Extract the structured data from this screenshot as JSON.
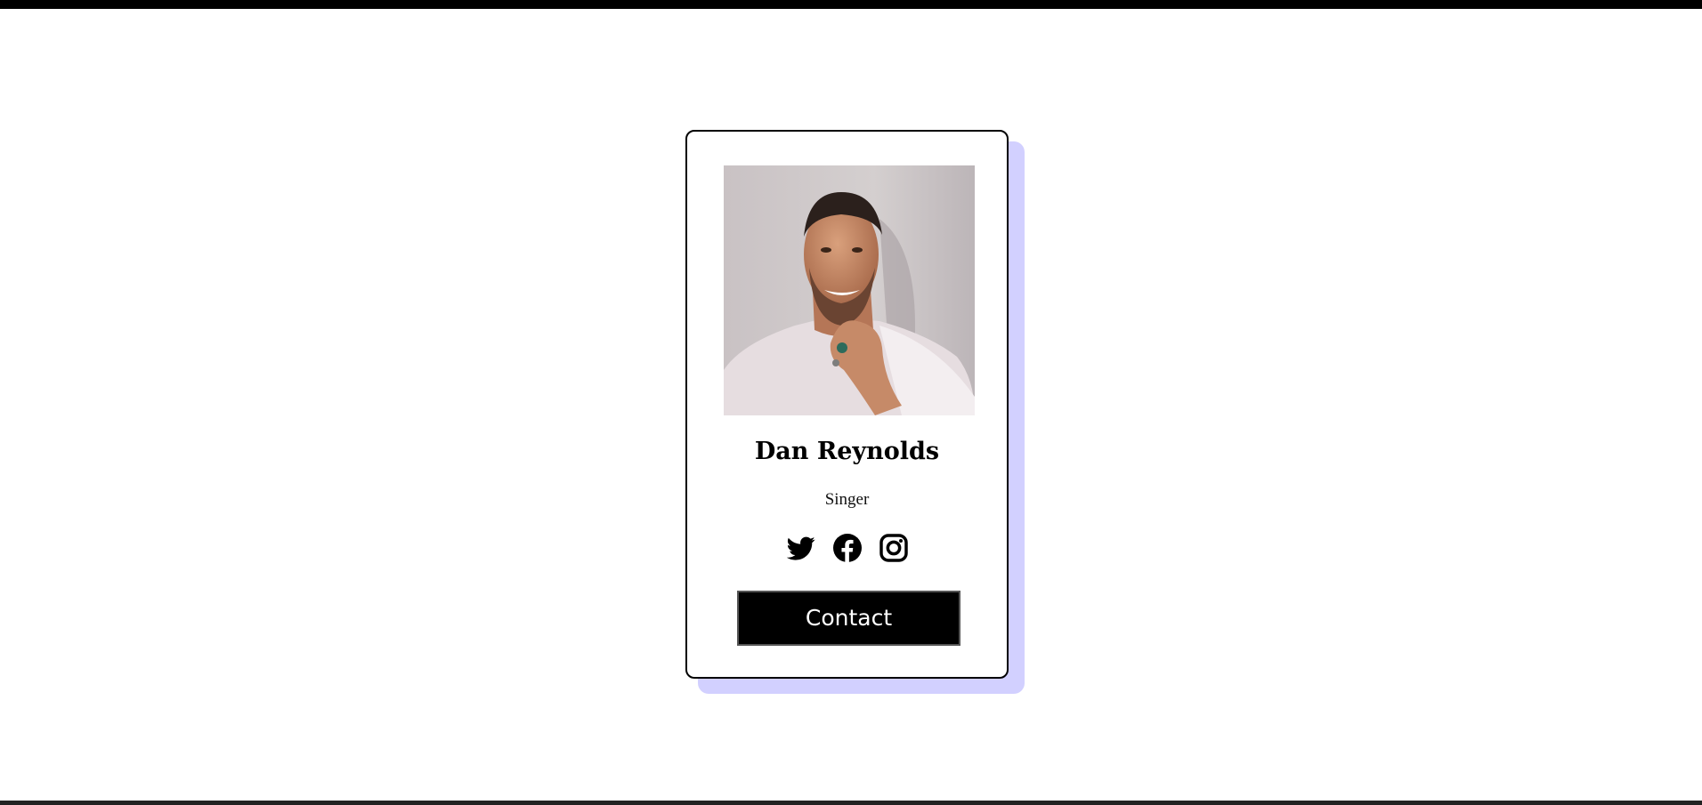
{
  "profile": {
    "name": "Dan Reynolds",
    "role": "Singer",
    "photo_alt": "Dan Reynolds"
  },
  "socials": [
    {
      "icon": "twitter-icon"
    },
    {
      "icon": "facebook-icon"
    },
    {
      "icon": "instagram-icon"
    }
  ],
  "contact": {
    "label": "Contact"
  },
  "colors": {
    "accent_shadow": "#d2d0ff",
    "button_bg": "#000000",
    "button_text": "#ffffff"
  }
}
